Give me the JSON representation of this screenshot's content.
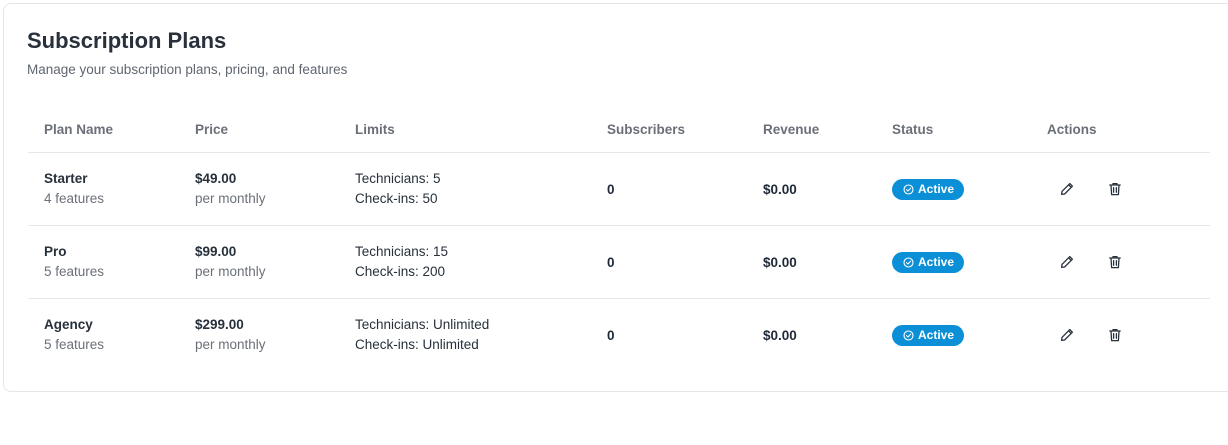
{
  "page": {
    "title": "Subscription Plans",
    "subtitle": "Manage your subscription plans, pricing, and features"
  },
  "table": {
    "columns": [
      "Plan Name",
      "Price",
      "Limits",
      "Subscribers",
      "Revenue",
      "Status",
      "Actions"
    ],
    "rows": [
      {
        "name": "Starter",
        "features": "4 features",
        "price": "$49.00",
        "period": "per monthly",
        "limit_technicians": "Technicians: 5",
        "limit_checkins": "Check-ins: 50",
        "subscribers": "0",
        "revenue": "$0.00",
        "status": "Active"
      },
      {
        "name": "Pro",
        "features": "5 features",
        "price": "$99.00",
        "period": "per monthly",
        "limit_technicians": "Technicians: 15",
        "limit_checkins": "Check-ins: 200",
        "subscribers": "0",
        "revenue": "$0.00",
        "status": "Active"
      },
      {
        "name": "Agency",
        "features": "5 features",
        "price": "$299.00",
        "period": "per monthly",
        "limit_technicians": "Technicians: Unlimited",
        "limit_checkins": "Check-ins: Unlimited",
        "subscribers": "0",
        "revenue": "$0.00",
        "status": "Active"
      }
    ]
  },
  "icons": {
    "status": "check-circle-icon",
    "edit": "pencil-icon",
    "delete": "trash-icon"
  },
  "colors": {
    "status_badge": "#0b8fd6",
    "divider": "#e5e7eb"
  }
}
